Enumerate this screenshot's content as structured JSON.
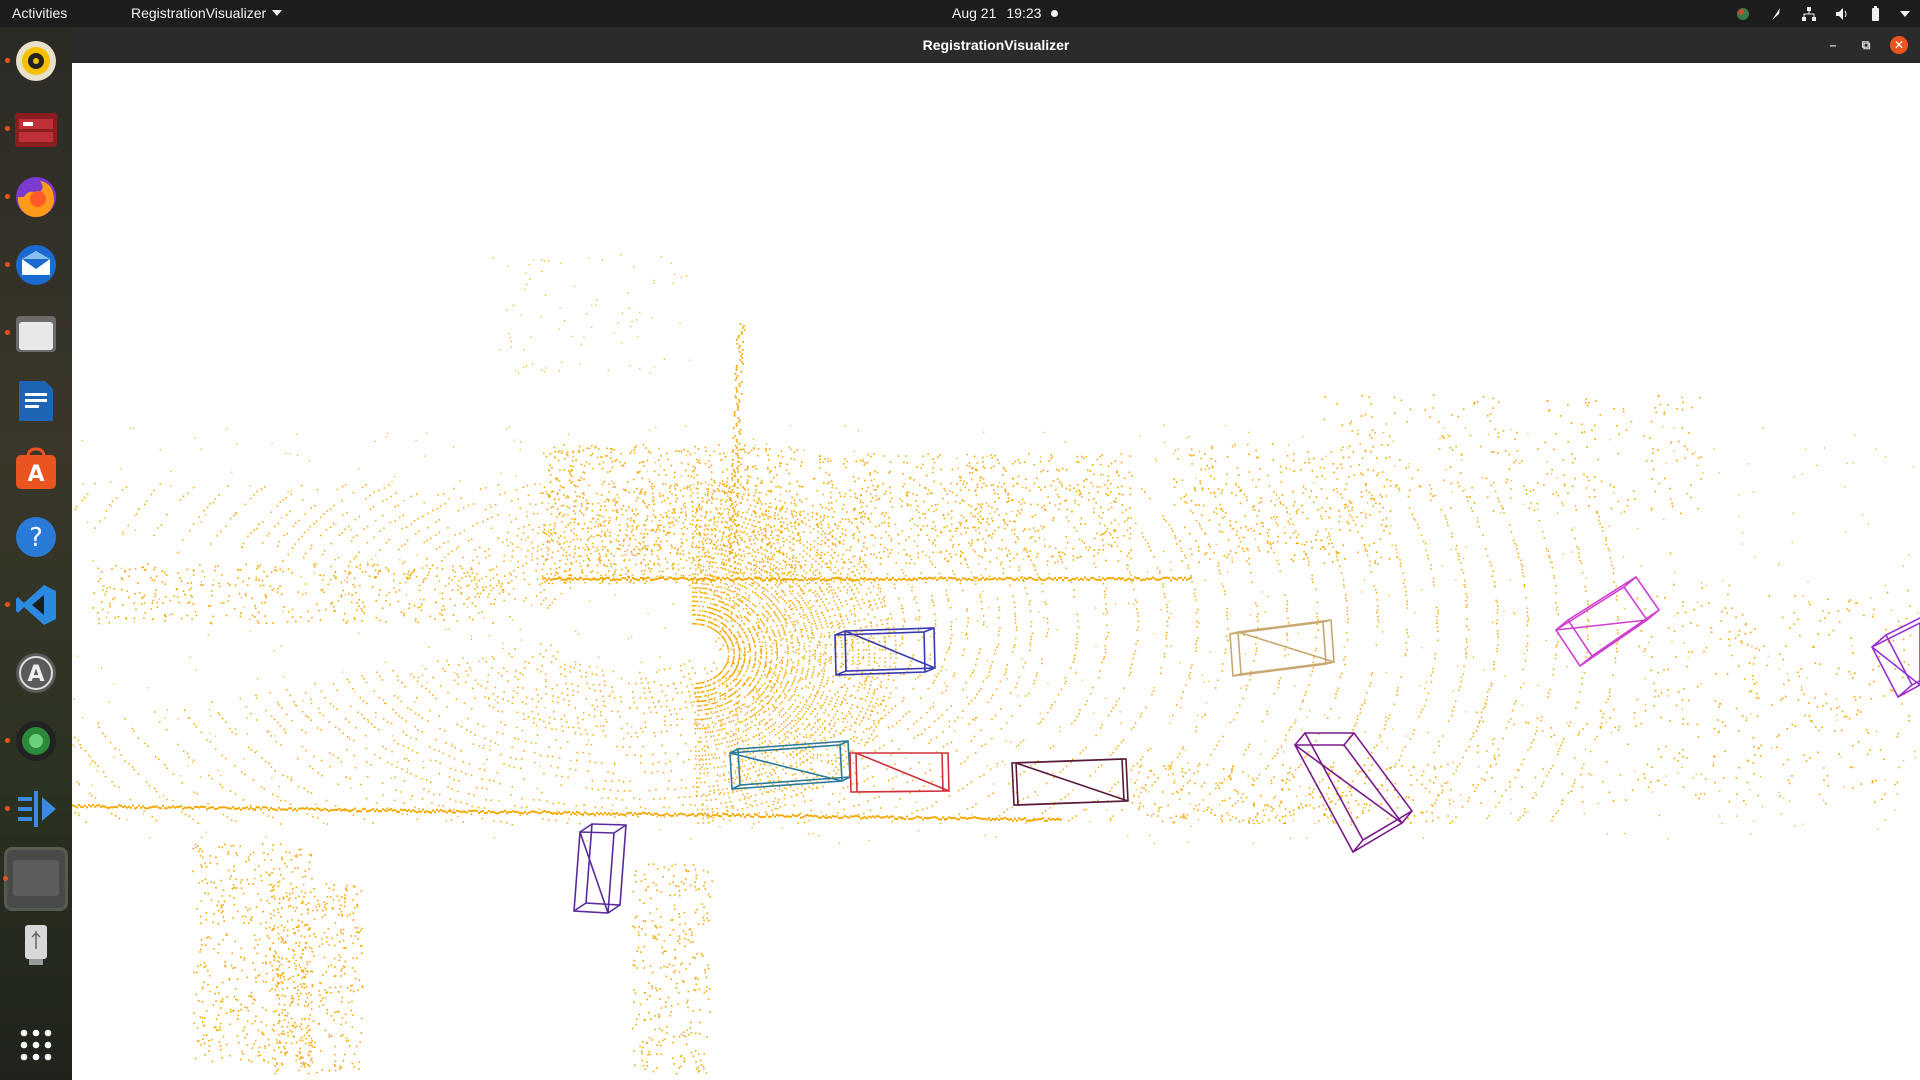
{
  "topbar": {
    "activities": "Activities",
    "app_menu": "RegistrationVisualizer",
    "date": "Aug 21",
    "time": "19:23"
  },
  "dock": {
    "items": [
      {
        "name": "rhythmbox-icon",
        "running": true
      },
      {
        "name": "terminal-app-icon",
        "running": true
      },
      {
        "name": "firefox-icon",
        "running": true
      },
      {
        "name": "thunderbird-icon",
        "running": true
      },
      {
        "name": "files-icon",
        "running": true
      },
      {
        "name": "libreoffice-writer-icon",
        "running": false
      },
      {
        "name": "ubuntu-software-icon",
        "running": false
      },
      {
        "name": "help-icon",
        "running": false
      },
      {
        "name": "vscode-icon",
        "running": true
      },
      {
        "name": "software-updater-icon",
        "running": false
      },
      {
        "name": "camera-app-icon",
        "running": true
      },
      {
        "name": "deploy-app-icon",
        "running": true
      },
      {
        "name": "active-window-icon",
        "running": true
      },
      {
        "name": "usb-drive-icon",
        "running": false
      }
    ],
    "show_apps": "show-applications-icon"
  },
  "window": {
    "title": "RegistrationVisualizer"
  },
  "scene": {
    "point_color": "#f5a800",
    "boxes": [
      {
        "name": "bbox-blue",
        "color": "#3a3ab0"
      },
      {
        "name": "bbox-teal",
        "color": "#2a7a9a"
      },
      {
        "name": "bbox-red",
        "color": "#d0303a"
      },
      {
        "name": "bbox-maroon",
        "color": "#5a1a3a"
      },
      {
        "name": "bbox-tan",
        "color": "#c8a870"
      },
      {
        "name": "bbox-purple",
        "color": "#7a1a8a"
      },
      {
        "name": "bbox-violet",
        "color": "#5a2a9a"
      },
      {
        "name": "bbox-magenta",
        "color": "#d040d0"
      },
      {
        "name": "bbox-purple-edge",
        "color": "#9a30d0"
      }
    ]
  }
}
